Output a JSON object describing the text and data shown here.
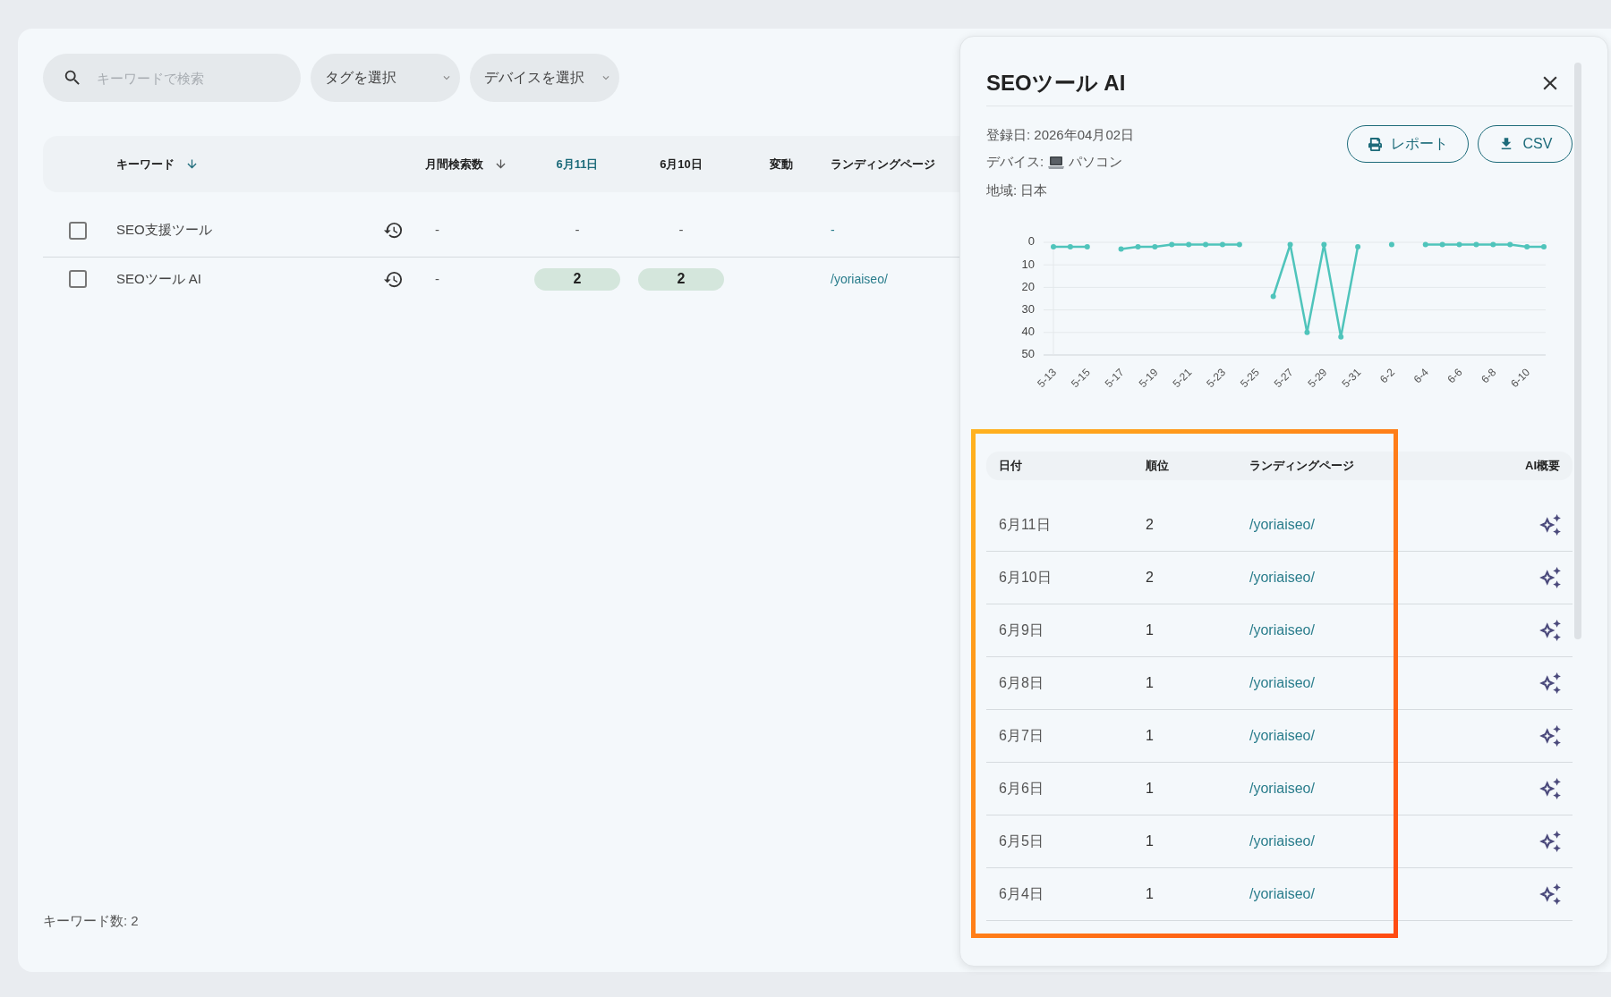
{
  "toolbar": {
    "search": {
      "placeholder": "キーワードで検索"
    },
    "selects": [
      {
        "label": "タグを選択"
      },
      {
        "label": "デバイスを選択"
      }
    ]
  },
  "table": {
    "columns": [
      {
        "label": "キーワード",
        "sortable": true,
        "sorted": true,
        "highlighted": false
      },
      {
        "label": "月間検索数",
        "sortable": true,
        "sorted": false,
        "highlighted": false
      },
      {
        "label": "6月11日",
        "sortable": false,
        "highlighted": true
      },
      {
        "label": "6月10日",
        "sortable": false,
        "highlighted": false
      },
      {
        "label": "変動",
        "sortable": false,
        "highlighted": false
      },
      {
        "label": "ランディングページ",
        "sortable": false,
        "highlighted": false
      }
    ],
    "rows": [
      {
        "checked": false,
        "keyword": "SEO支援ツール",
        "monthly_searches": "-",
        "ranks": [
          {
            "text": "-",
            "badge": false
          },
          {
            "text": "-",
            "badge": false
          }
        ],
        "landing_page": "-"
      },
      {
        "checked": false,
        "keyword": "SEOツール AI",
        "monthly_searches": "-",
        "ranks": [
          {
            "text": "2",
            "badge": true
          },
          {
            "text": "2",
            "badge": true
          }
        ],
        "landing_page": "/yoriaiseo/"
      }
    ]
  },
  "keyword_count": "キーワード数: 2",
  "panel": {
    "title": "SEOツール AI",
    "registered": "登録日: 2026年04月02日",
    "device": {
      "label": "デバイス:",
      "value": "パソコン"
    },
    "region": "地域: 日本",
    "buttons": [
      {
        "label": "レポート",
        "kind": "print"
      },
      {
        "label": "CSV",
        "kind": "download"
      }
    ],
    "chart_data": {
      "type": "line",
      "grid": true,
      "categories": [
        "5-13",
        null,
        "5-15",
        null,
        "5-17",
        null,
        "5-19",
        null,
        "5-21",
        null,
        "5-23",
        null,
        "5-25",
        null,
        "5-27",
        null,
        "5-29",
        null,
        "5-31",
        null,
        "6-2",
        null,
        "6-4",
        null,
        "6-6",
        null,
        "6-8",
        null,
        "6-10",
        null
      ],
      "ylim": [
        50,
        0
      ],
      "yticks": [
        0,
        10,
        20,
        30,
        40,
        50
      ],
      "series": [
        {
          "color": "#4fc4bb",
          "marker": "circle",
          "values": [
            2,
            2,
            2,
            null,
            3,
            2,
            2,
            1,
            1,
            1,
            1,
            1,
            null,
            24,
            1,
            40,
            1,
            42,
            2,
            null,
            1,
            null,
            1,
            1,
            1,
            1,
            1,
            1,
            2,
            2
          ]
        }
      ]
    },
    "history": {
      "columns": [
        "日付",
        "順位",
        "ランディングページ",
        "AI概要"
      ],
      "rows": [
        {
          "date": "6月11日",
          "rank": "2",
          "landing_page": "/yoriaiseo/"
        },
        {
          "date": "6月10日",
          "rank": "2",
          "landing_page": "/yoriaiseo/"
        },
        {
          "date": "6月9日",
          "rank": "1",
          "landing_page": "/yoriaiseo/"
        },
        {
          "date": "6月8日",
          "rank": "1",
          "landing_page": "/yoriaiseo/"
        },
        {
          "date": "6月7日",
          "rank": "1",
          "landing_page": "/yoriaiseo/"
        },
        {
          "date": "6月6日",
          "rank": "1",
          "landing_page": "/yoriaiseo/"
        },
        {
          "date": "6月5日",
          "rank": "1",
          "landing_page": "/yoriaiseo/"
        },
        {
          "date": "6月4日",
          "rank": "1",
          "landing_page": "/yoriaiseo/"
        }
      ]
    }
  }
}
